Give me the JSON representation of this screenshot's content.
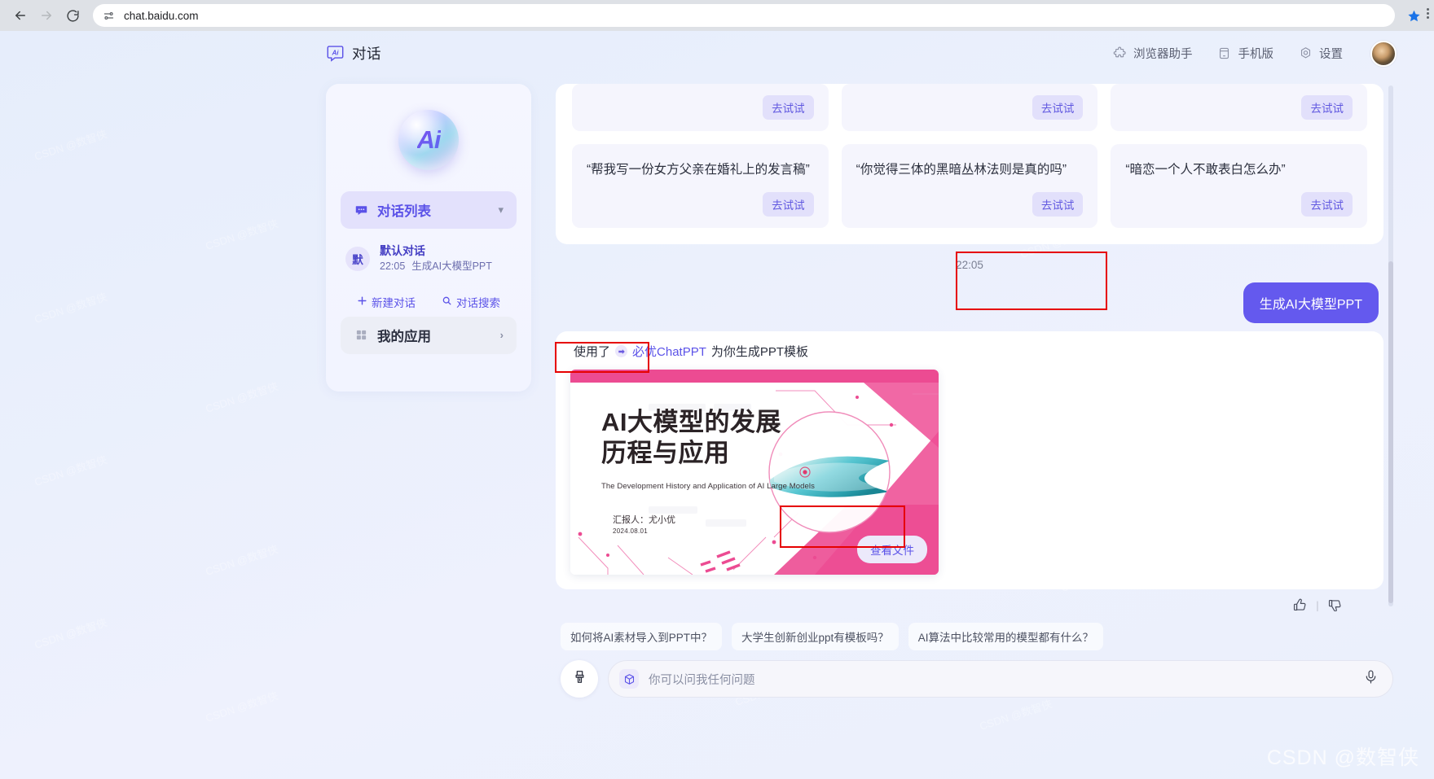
{
  "browser": {
    "back_icon": "back-arrow-icon",
    "forward_icon": "forward-arrow-icon",
    "reload_icon": "reload-icon",
    "site_settings_icon": "site-settings-icon",
    "url": "chat.baidu.com",
    "bookmark_icon": "star-icon",
    "menu_icon": "kebab-menu-icon",
    "toolbar_bg": "#dee1e6"
  },
  "header": {
    "logo_text": "Ai",
    "title": "对话",
    "actions": [
      {
        "icon": "puzzle-icon",
        "label": "浏览器助手"
      },
      {
        "icon": "mobile-icon",
        "label": "手机版"
      },
      {
        "icon": "gear-icon",
        "label": "设置"
      }
    ],
    "avatar": "user-avatar"
  },
  "sidebar": {
    "logo_text": "Ai",
    "nav": [
      {
        "id": "conversation-list",
        "label": "对话列表",
        "icon": "chat-bubble-icon",
        "active": true,
        "chevron": "▾"
      },
      {
        "id": "my-apps",
        "label": "我的应用",
        "icon": "grid-icon",
        "active": false,
        "chevron": "›"
      }
    ],
    "conversations": [
      {
        "avatar": "默",
        "title": "默认对话",
        "time": "22:05",
        "preview": "生成AI大模型PPT"
      }
    ],
    "actions": [
      {
        "id": "new-conversation",
        "icon": "plus-icon",
        "label": "新建对话"
      },
      {
        "id": "search-conversation",
        "icon": "search-icon",
        "label": "对话搜索"
      }
    ]
  },
  "chat": {
    "suggestion_cards_top": [
      {
        "try_label": "去试试"
      },
      {
        "try_label": "去试试"
      },
      {
        "try_label": "去试试"
      }
    ],
    "suggestion_cards": [
      {
        "text": "“帮我写一份女方父亲在婚礼上的发言稿”",
        "try_label": "去试试"
      },
      {
        "text": "“你觉得三体的黑暗丛林法则是真的吗”",
        "try_label": "去试试"
      },
      {
        "text": "“暗恋一个人不敢表白怎么办”",
        "try_label": "去试试"
      }
    ],
    "timestamp": "22:05",
    "user_message": "生成AI大模型PPT",
    "assistant": {
      "used_prefix": "使用了",
      "plugin_name": "必优ChatPPT",
      "used_suffix": "为你生成PPT模板",
      "slide": {
        "title_line1": "AI大模型的发展",
        "title_line2": "历程与应用",
        "subtitle": "The Development History and Application of AI Large Models",
        "presenter": "汇报人：尤小优",
        "date": "2024.08.01",
        "accent_color": "#ec4b92"
      },
      "view_file_label": "查看文件",
      "feedback": [
        {
          "id": "thumbs-up",
          "icon": "thumbs-up-icon"
        },
        {
          "id": "thumbs-down",
          "icon": "thumbs-down-icon"
        }
      ]
    }
  },
  "bottom": {
    "chips": [
      "如何将AI素材导入到PPT中？",
      "大学生创新创业ppt有模板吗？",
      "AI算法中比较常用的模型都有什么？"
    ],
    "brush_icon": "brush-icon",
    "model_badge_icon": "cube-icon",
    "input_placeholder": "你可以问我任何问题",
    "mic_icon": "microphone-icon"
  },
  "watermark": "CSDN @数智侠",
  "colors": {
    "accent_purple": "#5b52e8",
    "bubble_purple": "#6459ee",
    "annotation_red": "#e60000",
    "slide_pink": "#ec4b92"
  }
}
